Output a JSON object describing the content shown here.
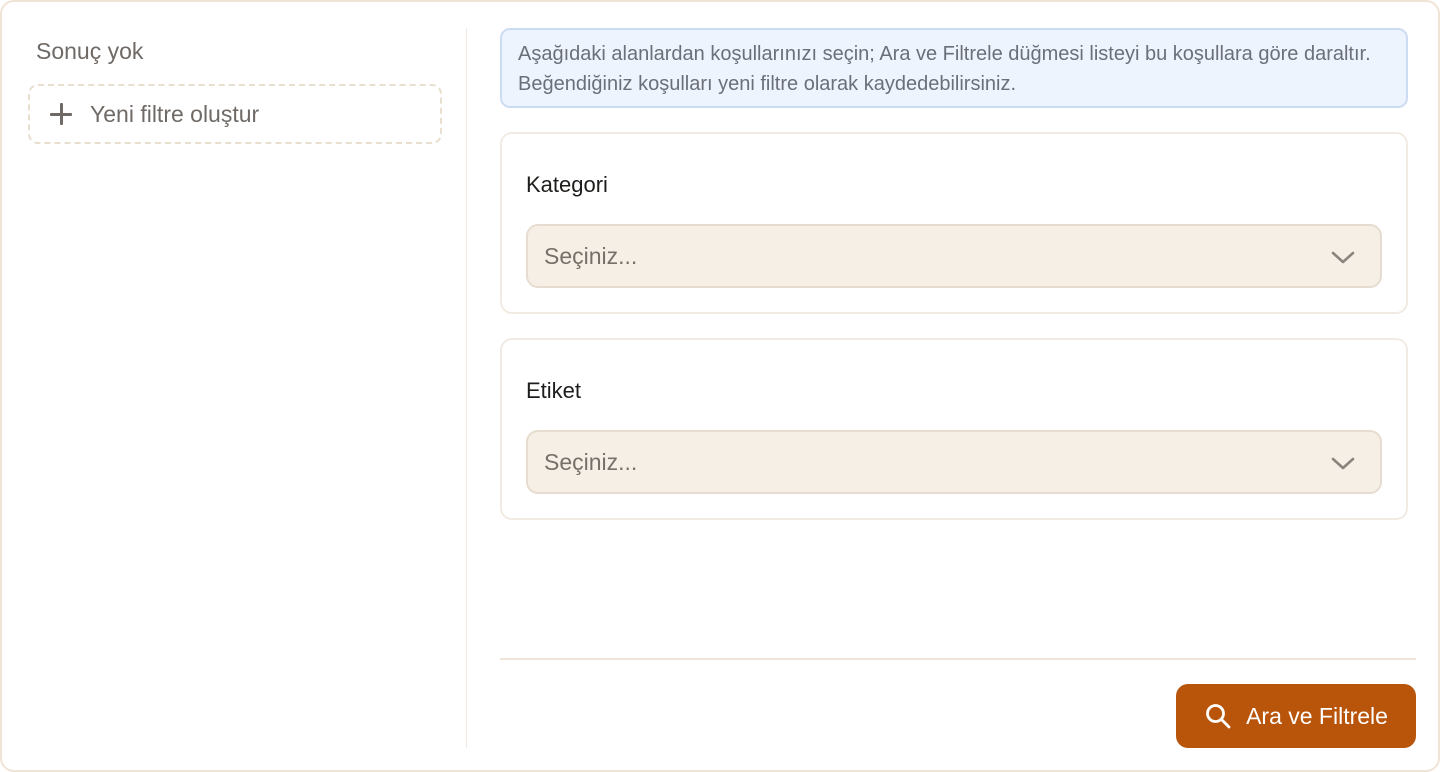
{
  "sidebar": {
    "empty_text": "Sonuç yok",
    "new_filter_label": "Yeni filtre oluştur",
    "new_filter_icon": "plus-icon"
  },
  "info": {
    "text": "Aşağıdaki alanlardan koşullarınızı seçin; Ara ve Filtrele düğmesi listeyi bu koşullara göre daraltır. Beğendiğiniz koşulları yeni filtre olarak kaydedebilirsiniz."
  },
  "fields": {
    "category": {
      "label": "Kategori",
      "value": "Seçiniz..."
    },
    "tag": {
      "label": "Etiket",
      "value": "Seçiniz..."
    }
  },
  "actions": {
    "search_label": "Ara ve Filtrele",
    "search_icon": "search-icon"
  },
  "colors": {
    "accent": "#b8550b",
    "info_bg": "#eef4fd",
    "select_bg": "#f6efe6"
  }
}
